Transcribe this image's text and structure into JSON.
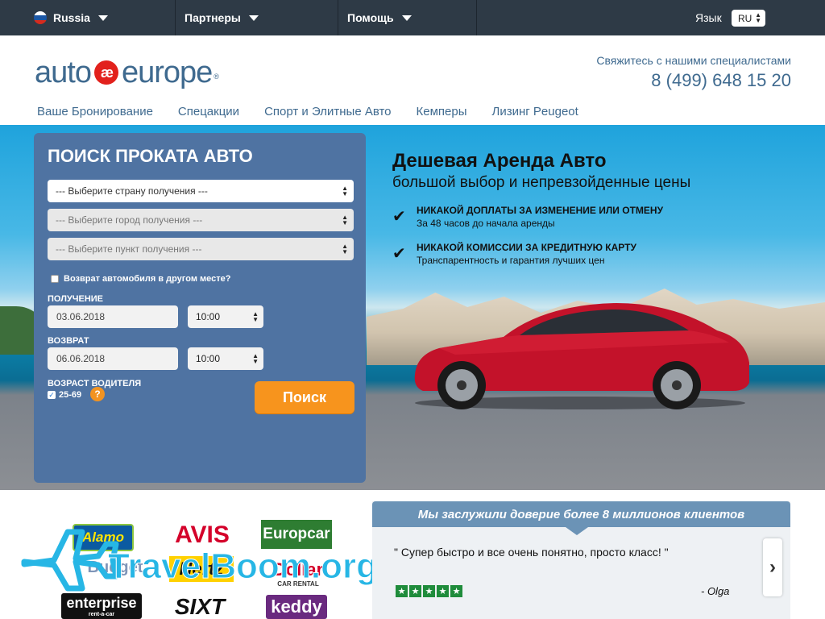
{
  "topbar": {
    "country": "Russia",
    "partners": "Партнеры",
    "help": "Помощь",
    "language_label": "Язык",
    "language_value": "RU"
  },
  "header": {
    "logo_left": "auto",
    "logo_mark": "æ",
    "logo_right": "europe",
    "logo_reg": "®",
    "contact_line": "Свяжитесь с нашими специалистами",
    "phone": "8 (499) 648 15 20"
  },
  "nav": {
    "items": [
      "Ваше Бронирование",
      "Спецакции",
      "Спорт и Элитные Авто",
      "Кемперы",
      "Лизинг Peugeot"
    ]
  },
  "search": {
    "title": "ПОИСК ПРОКАТА АВТО",
    "country_select": "--- Выберите страну получения ---",
    "city_select": "--- Выберите город получения ---",
    "location_select": "--- Выберите пункт получения ---",
    "return_other_label": "Возврат автомобиля в другом месте?",
    "pickup_label": "ПОЛУЧЕНИЕ",
    "pickup_date": "03.06.2018",
    "pickup_time": "10:00",
    "return_label": "ВОЗВРАТ",
    "return_date": "06.06.2018",
    "return_time": "10:00",
    "driver_age_label": "ВОЗРАСТ ВОДИТЕЛЯ",
    "driver_age_value": "25-69",
    "help_mark": "?",
    "search_button": "Поиск"
  },
  "promo": {
    "title": "Дешевая Аренда Авто",
    "subtitle": "большой выбор и непревзойденные цены",
    "features": [
      {
        "heading": "НИКАКОЙ ДОПЛАТЫ ЗА ИЗМЕНЕНИЕ ИЛИ ОТМЕНУ",
        "text": "За 48 часов до начала аренды"
      },
      {
        "heading": "НИКАКОЙ КОМИССИИ ЗА КРЕДИТНУЮ КАРТУ",
        "text": "Транспарентность и гарантия лучших цен"
      }
    ],
    "tick": "✔"
  },
  "partners": {
    "alamo": "Alamo",
    "avis": "AVIS",
    "europcar": "Europcar",
    "budget": "Budget",
    "hertz": "Hertz",
    "dollar": "Dollar",
    "dollar_sub": "CAR RENTAL",
    "enterprise": "enterprise",
    "enterprise_sub": "rent-a-car",
    "sixt": "SIXT",
    "keddy": "keddy",
    "watermark": "TravelBoom.org"
  },
  "reviews": {
    "header": "Мы заслужили доверие более 8 миллионов клиентов",
    "quote": "\" Супер быстро и все очень понятно, просто класс! \"",
    "author": "- Olga",
    "rating": 5,
    "star": "★",
    "next_icon": "›"
  },
  "colors": {
    "topbar": "#2e3a46",
    "brand_blue": "#3f6a8f",
    "panel": "#4f73a2",
    "search_button": "#f7941d",
    "stars": "#1f8c3b"
  }
}
